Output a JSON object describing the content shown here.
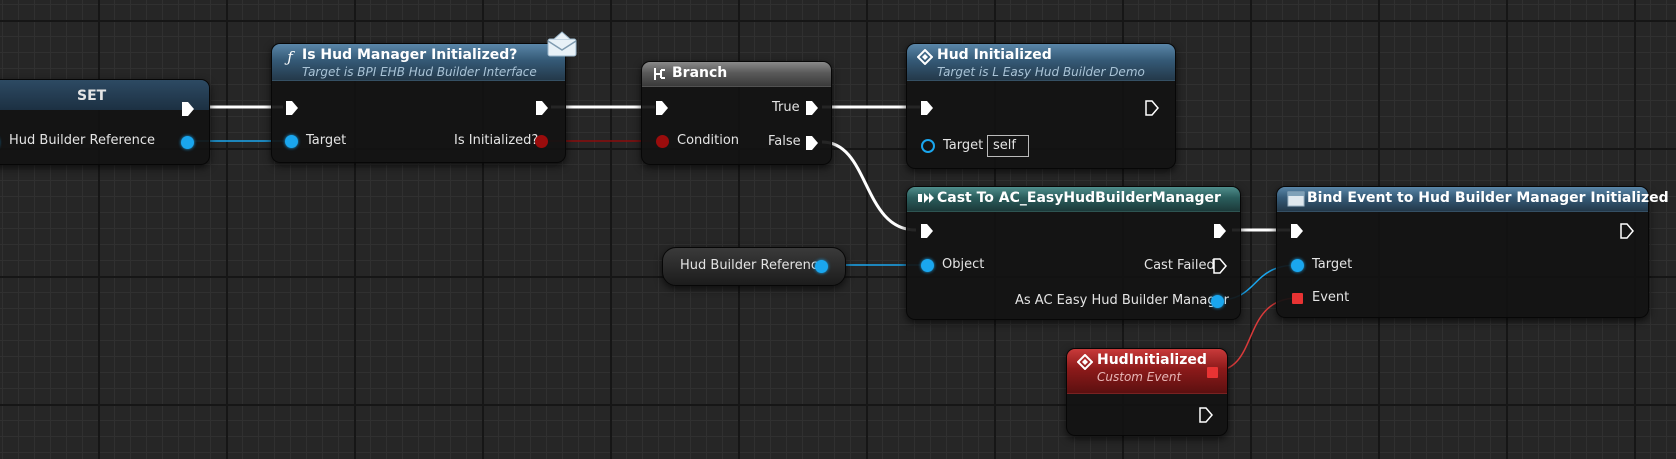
{
  "colors": {
    "exec_wire": "#ffffff",
    "object_pin": "#1aa6ee",
    "bool_pin": "#9a0c0c",
    "delegate_pin": "#e83333"
  },
  "set_node": {
    "title": "SET",
    "input_label": "Hud Builder Reference"
  },
  "is_hud_node": {
    "title": "Is Hud Manager Initialized?",
    "subtitle": "Target is BPI EHB Hud Builder Interface",
    "icon": "function-icon",
    "target_label": "Target",
    "output_label": "Is Initialized?"
  },
  "branch_node": {
    "title": "Branch",
    "icon": "branch-icon",
    "condition_label": "Condition",
    "true_label": "True",
    "false_label": "False"
  },
  "hud_init_node": {
    "title": "Hud Initialized",
    "subtitle": "Target is L Easy Hud Builder Demo",
    "icon": "event-diamond-icon",
    "target_label": "Target",
    "target_value": "self"
  },
  "cast_node": {
    "title": "Cast To AC_EasyHudBuilderManager",
    "icon": "cast-icon",
    "object_label": "Object",
    "cast_failed_label": "Cast Failed",
    "output_label": "As AC Easy Hud Builder Manager"
  },
  "bind_node": {
    "title": "Bind Event to Hud Builder Manager Initialized",
    "icon": "bind-event-icon",
    "target_label": "Target",
    "event_label": "Event"
  },
  "getter_node": {
    "label": "Hud Builder Reference"
  },
  "custom_event_node": {
    "title": "HudInitialized",
    "subtitle": "Custom Event",
    "icon": "event-diamond-icon"
  }
}
